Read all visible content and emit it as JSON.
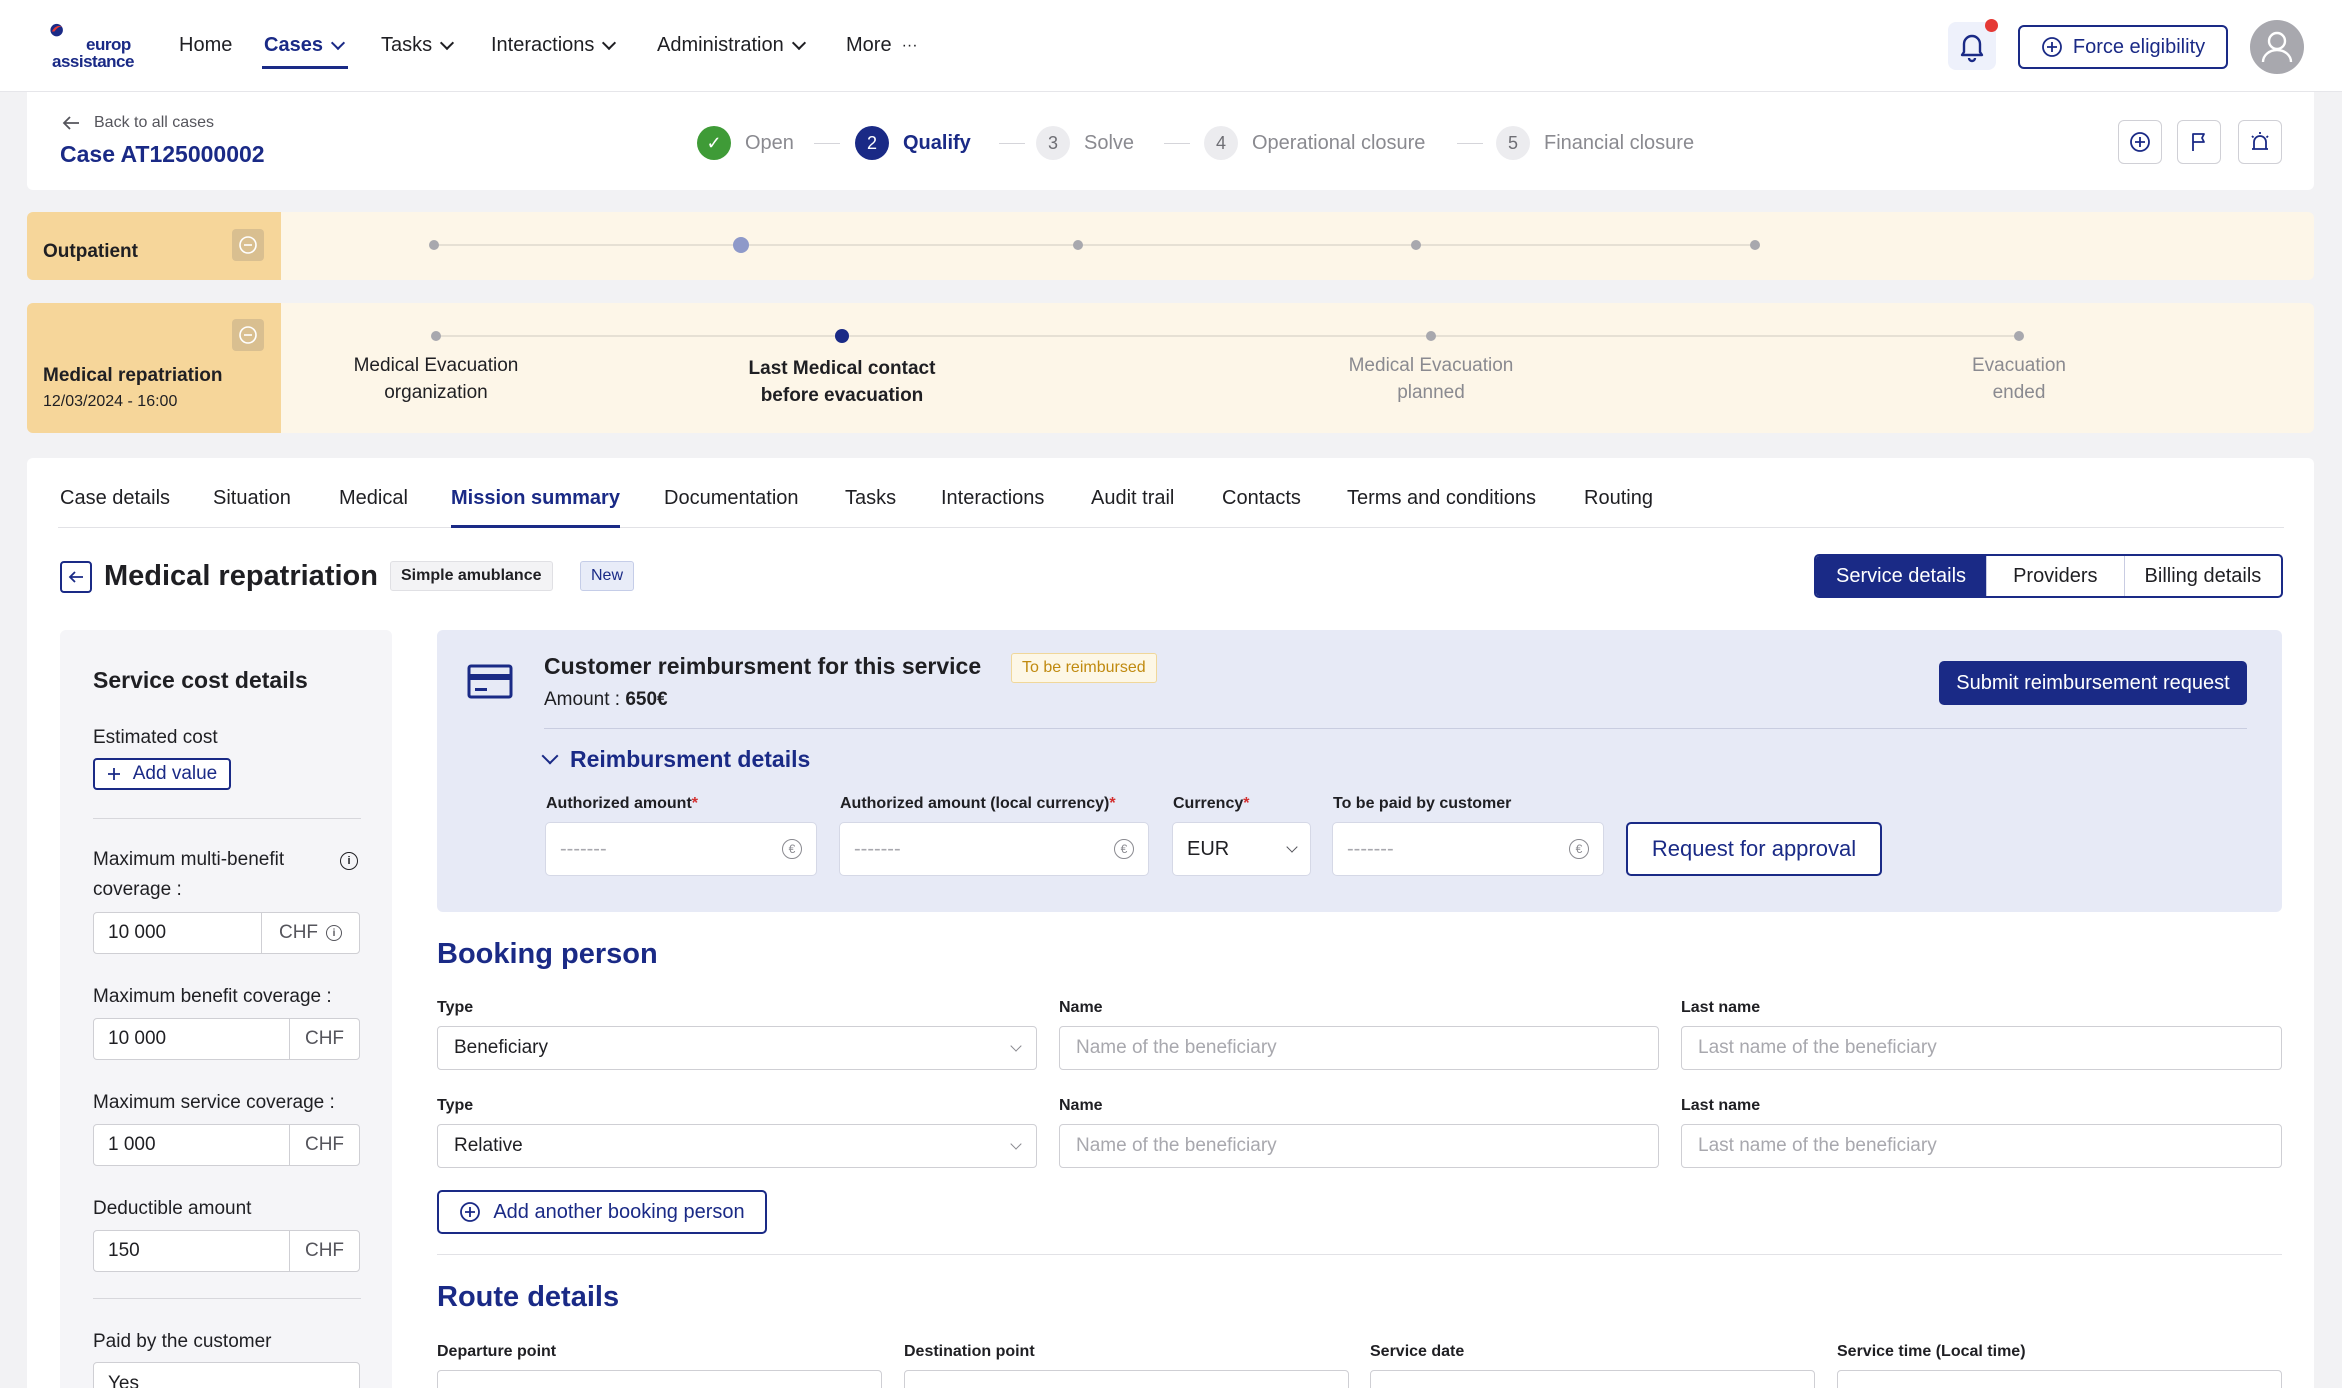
{
  "nav": {
    "logo_line1": "europ",
    "logo_line2": "assistance",
    "items": [
      {
        "label": "Home",
        "dropdown": false
      },
      {
        "label": "Cases",
        "dropdown": true,
        "active": true
      },
      {
        "label": "Tasks",
        "dropdown": true
      },
      {
        "label": "Interactions",
        "dropdown": true
      },
      {
        "label": "Administration",
        "dropdown": true
      },
      {
        "label": "More",
        "suffix": "···"
      }
    ],
    "force_eligibility": "Force eligibility",
    "icons": [
      "bell-icon",
      "plus-circle-icon",
      "avatar-icon"
    ]
  },
  "case": {
    "back_label": "Back to all cases",
    "title": "Case AT125000002",
    "steps": [
      {
        "num": "✓",
        "label": "Open",
        "state": "done"
      },
      {
        "num": "2",
        "label": "Qualify",
        "state": "current"
      },
      {
        "num": "3",
        "label": "Solve",
        "state": "todo"
      },
      {
        "num": "4",
        "label": "Operational closure",
        "state": "todo"
      },
      {
        "num": "5",
        "label": "Financial closure",
        "state": "todo"
      }
    ]
  },
  "bands": {
    "outpatient": {
      "title": "Outpatient"
    },
    "repatriation": {
      "title": "Medical repatriation",
      "datetime": "12/03/2024 - 16:00",
      "milestones": [
        {
          "line1": "Medical Evacuation",
          "line2": "organization",
          "state": "done"
        },
        {
          "line1": "Last Medical contact",
          "line2": "before evacuation",
          "state": "current"
        },
        {
          "line1": "Medical Evacuation",
          "line2": "planned",
          "state": "todo"
        },
        {
          "line1": "Evacuation",
          "line2": "ended",
          "state": "todo"
        }
      ]
    }
  },
  "tabs": [
    "Case details",
    "Situation",
    "Medical",
    "Mission summary",
    "Documentation",
    "Tasks",
    "Interactions",
    "Audit trail",
    "Contacts",
    "Terms and conditions",
    "Routing"
  ],
  "active_tab": "Mission summary",
  "service": {
    "title": "Medical repatriation",
    "chip_type": "Simple amublance",
    "chip_status": "New",
    "segments": [
      "Service details",
      "Providers",
      "Billing details"
    ]
  },
  "sidebar": {
    "title": "Service cost details",
    "estimated_cost_label": "Estimated cost",
    "add_value": "Add value",
    "max_multi_label1": "Maximum multi-benefit",
    "max_multi_label2": "coverage :",
    "max_multi_value": "10 000",
    "max_multi_currency": "CHF",
    "max_benefit_label": "Maximum benefit coverage :",
    "max_benefit_value": "10 000",
    "max_benefit_currency": "CHF",
    "max_service_label": "Maximum service coverage :",
    "max_service_value": "1 000",
    "max_service_currency": "CHF",
    "deductible_label": "Deductible amount",
    "deductible_value": "150",
    "deductible_currency": "CHF",
    "paid_label": "Paid by the customer",
    "paid_value": "Yes"
  },
  "reimbursement": {
    "title": "Customer reimbursment for this service",
    "badge": "To be reimbursed",
    "amount_label": "Amount : ",
    "amount_value": "650€",
    "submit": "Submit reimbursement request",
    "details_title": "Reimbursment details",
    "fields": {
      "authorized": {
        "label": "Authorized amount",
        "placeholder": "-------"
      },
      "authorized_local": {
        "label": "Authorized amount (local currency)",
        "placeholder": "-------"
      },
      "currency": {
        "label": "Currency",
        "value": "EUR"
      },
      "to_be_paid": {
        "label": "To be paid by customer",
        "placeholder": "-------"
      }
    },
    "request_approval": "Request for approval",
    "currency_symbol": "€"
  },
  "booking": {
    "title": "Booking person",
    "type_label": "Type",
    "name_label": "Name",
    "last_label": "Last name",
    "rows": [
      {
        "type": "Beneficiary",
        "name_ph": "Name of the beneficiary",
        "last_ph": "Last name of the beneficiary"
      },
      {
        "type": "Relative",
        "name_ph": "Name of the beneficiary",
        "last_ph": "Last name of the beneficiary"
      }
    ],
    "add_another": "Add another booking person"
  },
  "route": {
    "title": "Route details",
    "departure_label": "Departure point",
    "destination_label": "Destination point",
    "date_label": "Service date",
    "time_label": "Service time (Local time)"
  },
  "colors": {
    "brand": "#1a2a86",
    "accent_band": "#f6d69a",
    "success": "#3f9b37",
    "alert": "#e53935"
  }
}
